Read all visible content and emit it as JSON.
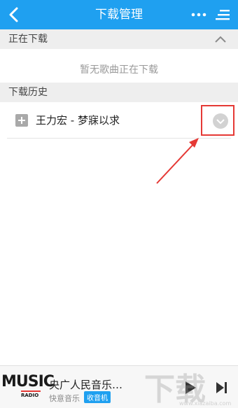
{
  "header": {
    "title": "下载管理",
    "back_icon": "chevron-left-icon",
    "more_icon": "more-horizontal-icon",
    "menu_icon": "menu-icon"
  },
  "downloading": {
    "title": "正在下载",
    "empty_message": "暂无歌曲正在下载",
    "collapse_icon": "chevron-up-icon"
  },
  "history": {
    "title": "下载历史",
    "items": [
      {
        "name": "王力宏 - 梦寐以求",
        "add_icon": "plus-square-icon",
        "expand_icon": "chevron-down-circle-icon"
      }
    ]
  },
  "player": {
    "logo_text": "MUSIC",
    "logo_sub": "RADIO",
    "station": "央广人民音乐…",
    "source": "快意音乐",
    "badge": "收音机",
    "play_icon": "play-icon",
    "next_icon": "skip-next-icon"
  },
  "watermark": {
    "mark": "下载",
    "url": "www.xiazaiba.com"
  },
  "colors": {
    "header_bg": "#1fa0f0",
    "annotation_red": "#e53935",
    "section_bg": "#eeeeee"
  }
}
